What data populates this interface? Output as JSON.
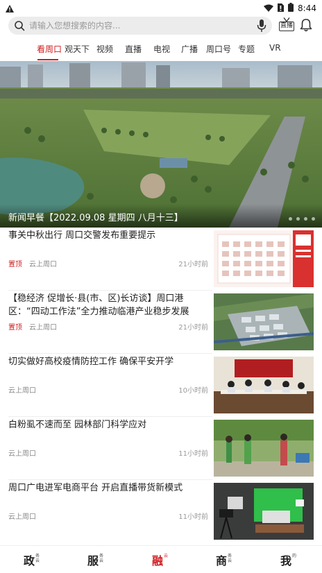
{
  "status_bar": {
    "time": "8:44"
  },
  "search": {
    "placeholder": "请输入您想搜索的内容..."
  },
  "header": {
    "live_label": "直播"
  },
  "tabs": [
    {
      "label": "看周口",
      "active": true
    },
    {
      "label": "观天下"
    },
    {
      "label": "视频"
    },
    {
      "label": "直播"
    },
    {
      "label": "电视"
    },
    {
      "label": "广播"
    },
    {
      "label": "周口号"
    },
    {
      "label": "专题"
    },
    {
      "label": "VR"
    }
  ],
  "hero": {
    "caption": "新闻早餐【2022.09.08 星期四 八月十三】",
    "indicator_count": 4
  },
  "news": [
    {
      "title": "事关中秋出行 周口交警发布重要提示",
      "pinned": "置顶",
      "source": "云上周口",
      "time": "21小时前",
      "thumb_icon": "calendar-thumb"
    },
    {
      "title": "【稳经济 促增长·县(市、区)长访谈】周口港区：“四动工作法”全力推动临港产业稳步发展",
      "pinned": "置顶",
      "source": "云上周口",
      "time": "21小时前",
      "thumb_icon": "port-aerial-thumb"
    },
    {
      "title": "切实做好高校疫情防控工作 确保平安开学",
      "pinned": "",
      "source": "云上周口",
      "time": "10小时前",
      "thumb_icon": "meeting-room-thumb"
    },
    {
      "title": "白粉虱不速而至 园林部门科学应对",
      "pinned": "",
      "source": "云上周口",
      "time": "11小时前",
      "thumb_icon": "garden-workers-thumb"
    },
    {
      "title": "周口广电进军电商平台 开启直播带货新模式",
      "pinned": "",
      "source": "云上周口",
      "time": "11小时前",
      "thumb_icon": "studio-thumb"
    }
  ],
  "bottom_nav": [
    {
      "big": "政",
      "small": "务云",
      "active": false
    },
    {
      "big": "服",
      "small": "务云",
      "active": false
    },
    {
      "big": "融",
      "small": "云",
      "active": true
    },
    {
      "big": "商",
      "small": "务云",
      "active": false
    },
    {
      "big": "我",
      "small": "的",
      "active": false
    }
  ],
  "colors": {
    "accent": "#d01c1f",
    "muted": "#888888"
  }
}
